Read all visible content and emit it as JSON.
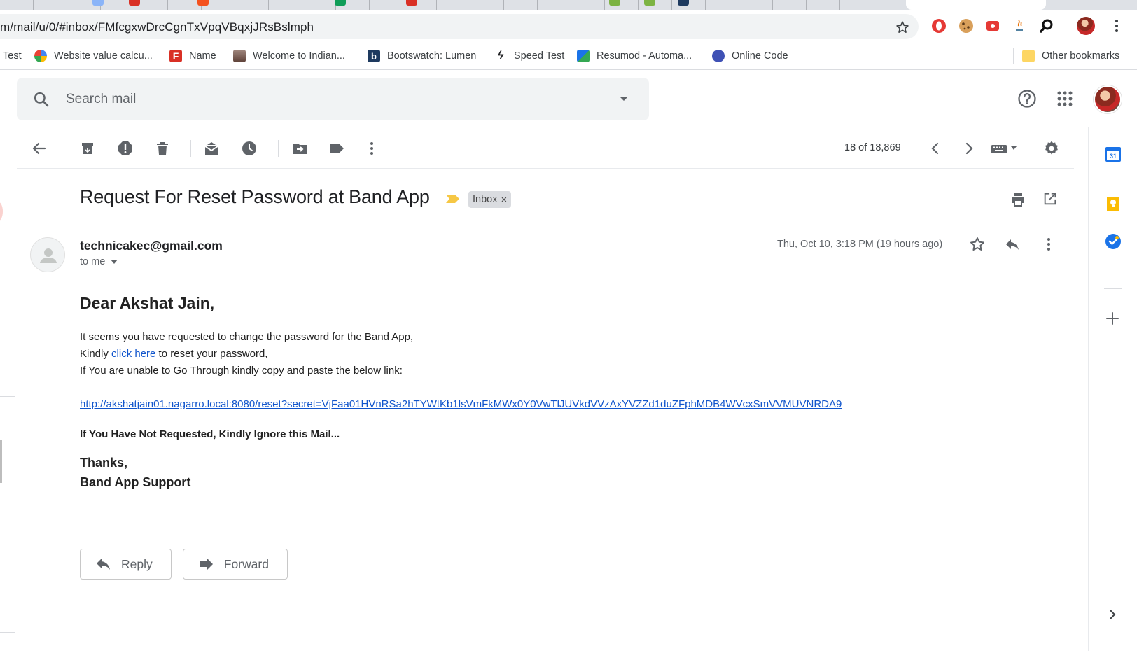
{
  "browser": {
    "url_visible": "m/mail/u/0/#inbox/FMfcgxwDrcCgnTxVpqVBqxjJRsBslmph",
    "bookmarks": [
      {
        "label": "Test",
        "icon": "none"
      },
      {
        "label": "Website value calcu...",
        "icon": "globe-icon",
        "color": "#4285f4"
      },
      {
        "label": "Name",
        "icon": "f-icon",
        "color": "#d93025"
      },
      {
        "label": "Welcome to Indian...",
        "icon": "emblem-icon",
        "color": "#8d6e63"
      },
      {
        "label": "Bootswatch: Lumen",
        "icon": "b-icon",
        "color": "#1e3a5f"
      },
      {
        "label": "Speed Test",
        "icon": "speed-icon",
        "color": "#202124"
      },
      {
        "label": "Resumod - Automa...",
        "icon": "resumod-icon",
        "color": "#1a73e8"
      },
      {
        "label": "Online Code",
        "icon": "code-icon",
        "color": "#3f51b5"
      }
    ],
    "other_bookmarks": "Other bookmarks"
  },
  "gmail": {
    "search_placeholder": "Search mail",
    "pager": "18 of 18,869",
    "email": {
      "subject": "Request For Reset Password at Band App",
      "label": "Inbox",
      "label_close": "×",
      "sender": "technicakec@gmail.com",
      "recipient": "to me",
      "date": "Thu, Oct 10, 3:18 PM (19 hours ago)",
      "greeting": "Dear Akshat Jain,",
      "line1": "It seems you have requested to change the password for the Band App,",
      "line2_pre": "Kindly ",
      "line2_link": "click here",
      "line2_post": " to reset your password,",
      "line3": "If You are unable to Go Through kindly copy and paste the below link:",
      "reset_link": "http://akshatjain01.nagarro.local:8080/reset?secret=VjFaa01HVnRSa2hTYWtKb1lsVmFkMWx0Y0VwTlJUVkdVVzAxYVZZd1duZFphMDB4WVcxSmVVMUVNRDA9",
      "ignore_note": "If You Have Not Requested, Kindly Ignore this Mail...",
      "thanks": "Thanks,",
      "signature": "Band App Support"
    },
    "reply_button": "Reply",
    "forward_button": "Forward",
    "calendar_day": "31"
  }
}
